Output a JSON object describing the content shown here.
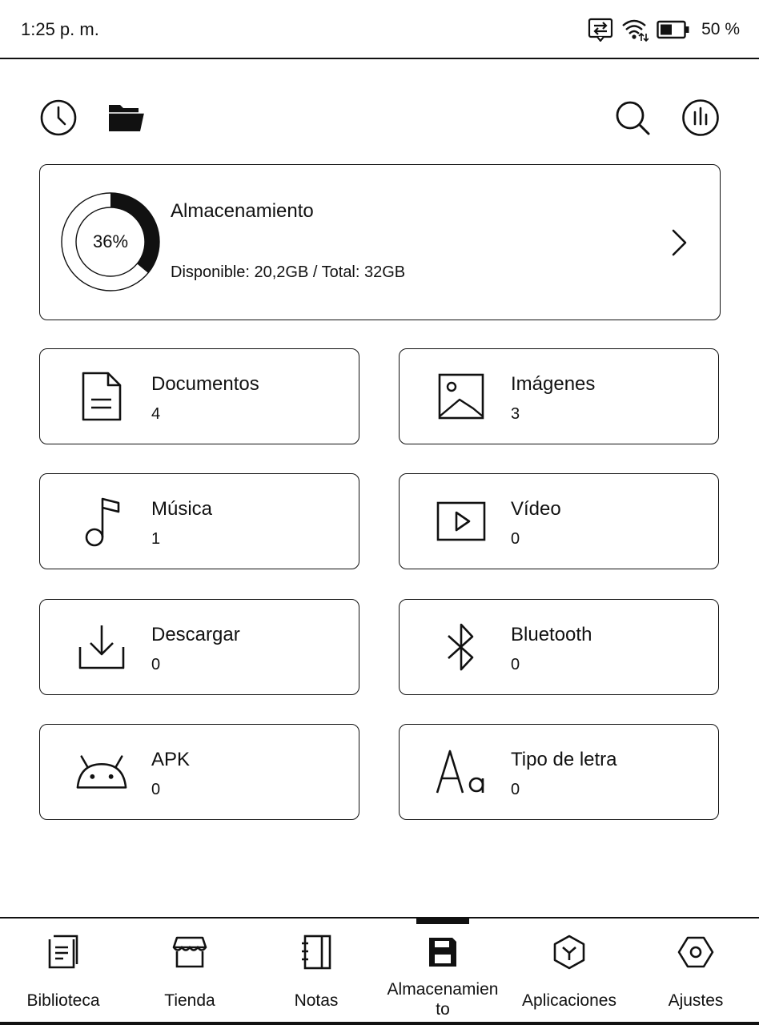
{
  "status_bar": {
    "time": "1:25 p. m.",
    "battery": "50 %",
    "icons": [
      "sync-icon",
      "wifi-icon",
      "battery-icon"
    ]
  },
  "toolbar": {
    "left_icons": [
      "recent-clock-icon",
      "folder-icon"
    ],
    "right_icons": [
      "search-icon",
      "storage-stats-icon"
    ]
  },
  "storage": {
    "title": "Almacenamiento",
    "percent_label": "36%",
    "used_fraction": 0.36,
    "detail": "Disponible: 20,2GB / Total: 32GB"
  },
  "categories": [
    {
      "name": "Documentos",
      "count": "4",
      "icon": "document-icon"
    },
    {
      "name": "Imágenes",
      "count": "3",
      "icon": "image-icon"
    },
    {
      "name": "Música",
      "count": "1",
      "icon": "music-note-icon"
    },
    {
      "name": "Vídeo",
      "count": "0",
      "icon": "video-icon"
    },
    {
      "name": "Descargar",
      "count": "0",
      "icon": "download-icon"
    },
    {
      "name": "Bluetooth",
      "count": "0",
      "icon": "bluetooth-icon"
    },
    {
      "name": "APK",
      "count": "0",
      "icon": "android-icon"
    },
    {
      "name": "Tipo de letra",
      "count": "0",
      "icon": "font-icon"
    }
  ],
  "bottom_nav": {
    "active": "Almacenamiento",
    "items": [
      {
        "label": "Biblioteca",
        "icon": "library-icon"
      },
      {
        "label": "Tienda",
        "icon": "store-icon"
      },
      {
        "label": "Notas",
        "icon": "notebook-icon"
      },
      {
        "label": "Almacenamien to",
        "icon": "storage-icon"
      },
      {
        "label": "Aplicaciones",
        "icon": "apps-icon"
      },
      {
        "label": "Ajustes",
        "icon": "settings-icon"
      }
    ]
  }
}
